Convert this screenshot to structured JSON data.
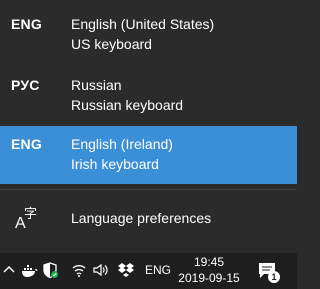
{
  "languages": [
    {
      "code": "ENG",
      "name": "English (United States)",
      "keyboard": "US keyboard",
      "selected": false
    },
    {
      "code": "РУС",
      "name": "Russian",
      "keyboard": "Russian keyboard",
      "selected": false
    },
    {
      "code": "ENG",
      "name": "English (Ireland)",
      "keyboard": "Irish keyboard",
      "selected": true
    }
  ],
  "preferences": {
    "icon": "language-settings-icon",
    "label": "Language preferences"
  },
  "taskbar": {
    "tray_icons": [
      "chevron-up-icon",
      "docker-icon",
      "windows-defender-icon",
      "wifi-icon",
      "volume-icon",
      "dropbox-icon"
    ],
    "input_indicator": "ENG",
    "time": "19:45",
    "date": "2019-09-15",
    "notification_count": "1"
  },
  "colors": {
    "background": "#2b2b2b",
    "selected": "#3b8fd6",
    "taskbar": "#1f1f1f",
    "text": "#ffffff"
  }
}
